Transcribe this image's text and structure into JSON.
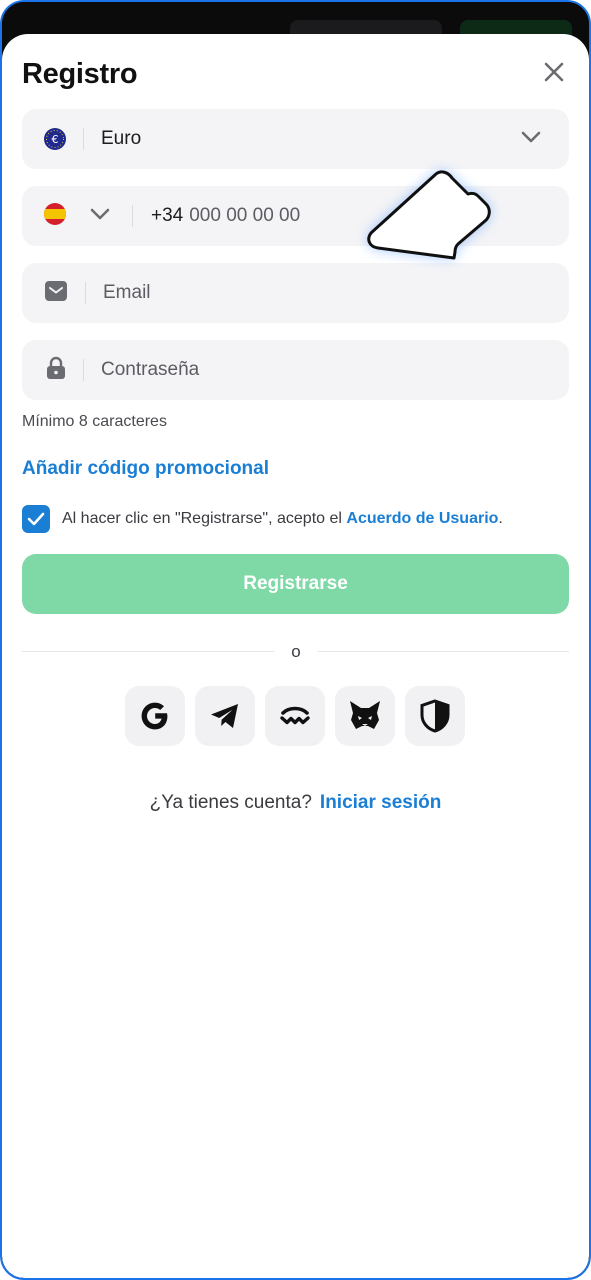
{
  "modal": {
    "title": "Registro"
  },
  "currency": {
    "selected": "Euro",
    "icon": "euro-coin-icon"
  },
  "phone": {
    "country_code": "+34",
    "placeholder": "000 00 00 00",
    "flag": "spain-flag-icon"
  },
  "email": {
    "placeholder": "Email",
    "icon": "envelope-icon"
  },
  "password": {
    "placeholder": "Contraseña",
    "hint": "Mínimo 8 caracteres",
    "icon": "lock-icon"
  },
  "promo": {
    "label": "Añadir código promocional"
  },
  "agreement": {
    "checked": true,
    "text": "Al hacer clic en \"Registrarse\", acepto el",
    "link": "Acuerdo de Usuario",
    "suffix": "."
  },
  "actions": {
    "register_label": "Registrarse",
    "divider_label": "o"
  },
  "socials": [
    {
      "icon": "google-icon"
    },
    {
      "icon": "telegram-icon"
    },
    {
      "icon": "walletconnect-icon"
    },
    {
      "icon": "metamask-fox-icon"
    },
    {
      "icon": "shield-icon"
    }
  ],
  "footer": {
    "question": "¿Ya tienes cuenta?",
    "login_link": "Iniciar sesión"
  },
  "colors": {
    "accent": "#1a7fd4",
    "register_button": "#7fd9a6",
    "field_background": "#f4f4f6"
  }
}
